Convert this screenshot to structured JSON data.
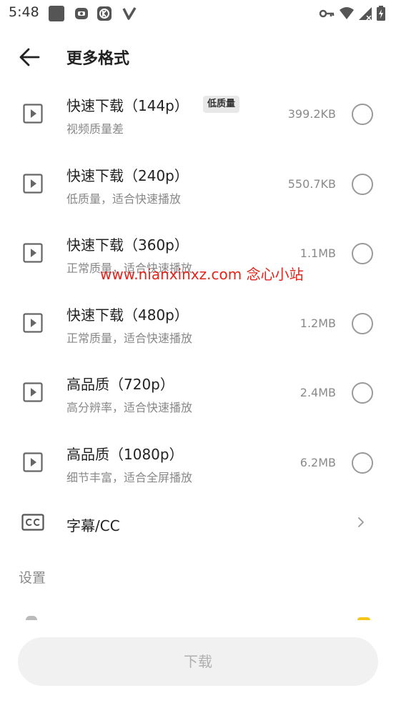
{
  "status_bar": {
    "time": "5:48",
    "icons": [
      "app-square-icon",
      "notification-icon",
      "tiktok-icon",
      "v-app-icon",
      "key-icon",
      "wifi-icon",
      "signal-icon",
      "battery-charging-icon"
    ]
  },
  "header": {
    "back_icon": "arrow-left-icon",
    "title": "更多格式"
  },
  "formats": [
    {
      "title": "快速下载（144p）",
      "badge": "低质量",
      "subtitle": "视频质量差",
      "size": "399.2KB",
      "selected": false
    },
    {
      "title": "快速下载（240p）",
      "subtitle": "低质量，适合快速播放",
      "size": "550.7KB",
      "selected": false
    },
    {
      "title": "快速下载（360p）",
      "subtitle": "正常质量，适合快速播放",
      "size": "1.1MB",
      "selected": false
    },
    {
      "title": "快速下载（480p）",
      "subtitle": "正常质量，适合快速播放",
      "size": "1.2MB",
      "selected": false
    },
    {
      "title": "高品质（720p）",
      "subtitle": "高分辨率，适合快速播放",
      "size": "2.4MB",
      "selected": false
    },
    {
      "title": "高品质（1080p）",
      "subtitle": "细节丰富，适合全屏播放",
      "size": "6.2MB",
      "selected": false
    }
  ],
  "subtitles_row": {
    "label": "字幕/CC",
    "icon": "cc-icon",
    "chevron": "chevron-right-icon"
  },
  "settings": {
    "section_title": "设置"
  },
  "watermark": "www.nianxinxz.com 念心小站",
  "download_button": {
    "label": "下载",
    "enabled": false
  },
  "colors": {
    "background": "#ffffff",
    "primary_text": "#222222",
    "secondary_text": "#888888",
    "button_bg": "#f1f1f1",
    "button_text_disabled": "#b0b0b0",
    "watermark": "#e3241b",
    "badge_bg": "#e8e8e8"
  }
}
